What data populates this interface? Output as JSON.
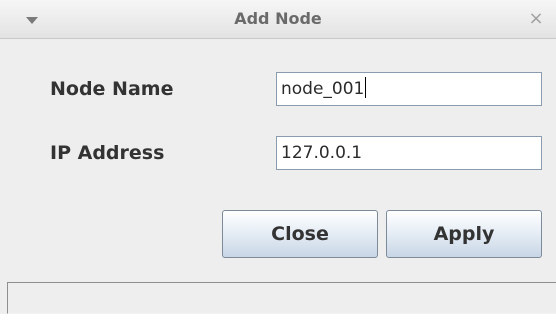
{
  "window": {
    "title": "Add Node",
    "menu_icon": "triangle-down-icon",
    "close_glyph": "×",
    "close_icon": "close-icon"
  },
  "form": {
    "node_name_label": "Node Name",
    "node_name_value": "node_001",
    "ip_address_label": "IP Address",
    "ip_address_value": "127.0.0.1"
  },
  "buttons": {
    "close_label": "Close",
    "apply_label": "Apply"
  },
  "status": {
    "text": ""
  }
}
